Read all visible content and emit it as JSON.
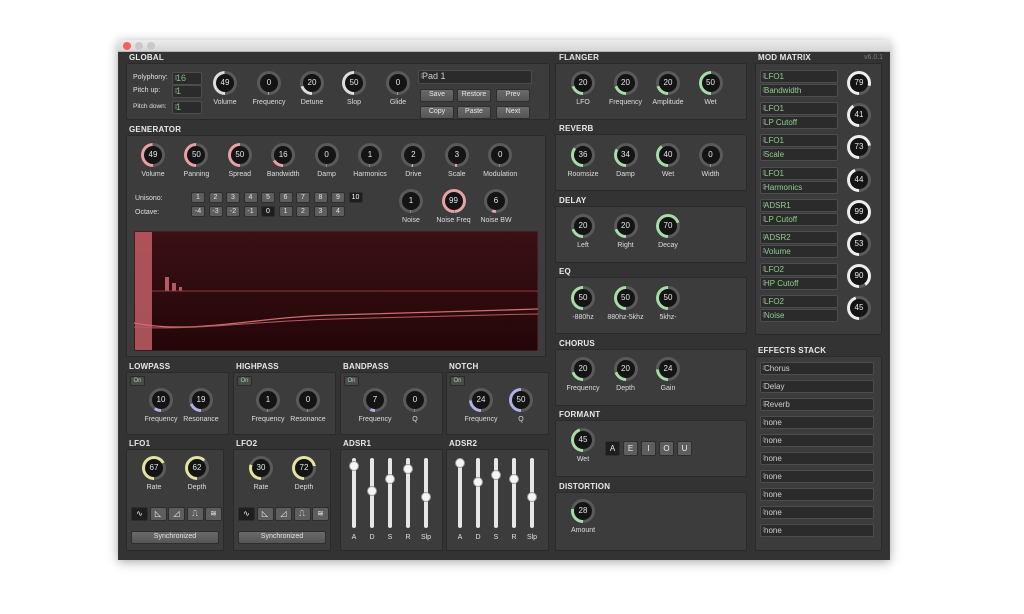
{
  "colors": {
    "accent": "#8fcf8f",
    "panel": "#3c3c3c",
    "window": "#333333"
  },
  "titlebar": {
    "version": "v6.0.1"
  },
  "global": {
    "title": "GLOBAL",
    "polyphony_label": "Polyphony:",
    "polyphony": "16",
    "pitch_up_label": "Pitch up:",
    "pitch_up": "1",
    "pitch_down_label": "Pitch down:",
    "pitch_down": "1",
    "knobs": [
      {
        "label": "Volume",
        "value": "49",
        "color": "#dddddd"
      },
      {
        "label": "Frequency",
        "value": "0",
        "color": "#dddddd"
      },
      {
        "label": "Detune",
        "value": "20",
        "color": "#dddddd"
      },
      {
        "label": "Slop",
        "value": "50",
        "color": "#dddddd"
      },
      {
        "label": "Glide",
        "value": "0",
        "color": "#dddddd"
      }
    ],
    "preset": "Pad 1",
    "buttons": {
      "save": "Save",
      "restore": "Restore",
      "prev": "Prev",
      "copy": "Copy",
      "paste": "Paste",
      "next": "Next"
    }
  },
  "generator": {
    "title": "GENERATOR",
    "knobs": [
      {
        "label": "Volume",
        "value": "49",
        "color": "#e8a0a6"
      },
      {
        "label": "Panning",
        "value": "50",
        "color": "#e8a0a6"
      },
      {
        "label": "Spread",
        "value": "50",
        "color": "#e8a0a6"
      },
      {
        "label": "Bandwidth",
        "value": "16",
        "color": "#e8a0a6"
      },
      {
        "label": "Damp",
        "value": "0",
        "color": "#e8a0a6"
      },
      {
        "label": "Harmonics",
        "value": "1",
        "color": "#e8a0a6"
      },
      {
        "label": "Drive",
        "value": "2",
        "color": "#e8a0a6"
      },
      {
        "label": "Scale",
        "value": "3",
        "color": "#e8a0a6"
      },
      {
        "label": "Modulation",
        "value": "0",
        "color": "#e8a0a6"
      }
    ],
    "unisono_label": "Unisono:",
    "unisono": [
      "1",
      "2",
      "3",
      "4",
      "5",
      "6",
      "7",
      "8",
      "9",
      "10"
    ],
    "octave_label": "Octave:",
    "octave": [
      "-4",
      "-3",
      "-2",
      "-1",
      "0",
      "1",
      "2",
      "3",
      "4"
    ],
    "noise_knobs": [
      {
        "label": "Noise",
        "value": "1",
        "color": "#e8a0a6"
      },
      {
        "label": "Noise Freq",
        "value": "99",
        "color": "#e8a0a6"
      },
      {
        "label": "Noise BW",
        "value": "6",
        "color": "#e8a0a6"
      }
    ]
  },
  "filters": [
    {
      "title": "LOWPASS",
      "on": "On",
      "knobs": [
        {
          "label": "Frequency",
          "value": "10",
          "color": "#b0b0e8"
        },
        {
          "label": "Resonance",
          "value": "19",
          "color": "#b0b0e8"
        }
      ]
    },
    {
      "title": "HIGHPASS",
      "on": "On",
      "knobs": [
        {
          "label": "Frequency",
          "value": "1",
          "color": "#b0b0e8"
        },
        {
          "label": "Resonance",
          "value": "0",
          "color": "#b0b0e8"
        }
      ]
    },
    {
      "title": "BANDPASS",
      "on": "On",
      "knobs": [
        {
          "label": "Frequency",
          "value": "7",
          "color": "#b0b0e8"
        },
        {
          "label": "Q",
          "value": "0",
          "color": "#b0b0e8"
        }
      ]
    },
    {
      "title": "NOTCH",
      "on": "On",
      "knobs": [
        {
          "label": "Frequency",
          "value": "24",
          "color": "#b0b0e8"
        },
        {
          "label": "Q",
          "value": "50",
          "color": "#b0b0e8"
        }
      ]
    }
  ],
  "lfos": [
    {
      "title": "LFO1",
      "knobs": [
        {
          "label": "Rate",
          "value": "67",
          "color": "#e6e2a0"
        },
        {
          "label": "Depth",
          "value": "62",
          "color": "#e6e2a0"
        }
      ],
      "sync": "Synchronized"
    },
    {
      "title": "LFO2",
      "knobs": [
        {
          "label": "Rate",
          "value": "30",
          "color": "#e6e2a0"
        },
        {
          "label": "Depth",
          "value": "72",
          "color": "#e6e2a0"
        }
      ],
      "sync": "Synchronized"
    }
  ],
  "adsr": [
    {
      "title": "ADSR1",
      "labels": [
        "A",
        "D",
        "S",
        "R",
        "Slp"
      ],
      "levels": [
        0.95,
        0.55,
        0.75,
        0.9,
        0.45
      ]
    },
    {
      "title": "ADSR2",
      "labels": [
        "A",
        "D",
        "S",
        "R",
        "Slp"
      ],
      "levels": [
        1.0,
        0.7,
        0.8,
        0.75,
        0.45
      ]
    }
  ],
  "fx": [
    {
      "title": "FLANGER",
      "knobs": [
        {
          "label": "LFO",
          "value": "20",
          "color": "#a6dca6"
        },
        {
          "label": "Frequency",
          "value": "20",
          "color": "#a6dca6"
        },
        {
          "label": "Amplitude",
          "value": "20",
          "color": "#a6dca6"
        },
        {
          "label": "Wet",
          "value": "50",
          "color": "#a6dca6"
        }
      ]
    },
    {
      "title": "REVERB",
      "knobs": [
        {
          "label": "Roomsize",
          "value": "36",
          "color": "#a6dca6"
        },
        {
          "label": "Damp",
          "value": "34",
          "color": "#a6dca6"
        },
        {
          "label": "Wet",
          "value": "40",
          "color": "#a6dca6"
        },
        {
          "label": "Width",
          "value": "0",
          "color": "#a6dca6"
        }
      ]
    },
    {
      "title": "DELAY",
      "knobs": [
        {
          "label": "Left",
          "value": "20",
          "color": "#a6dca6"
        },
        {
          "label": "Right",
          "value": "20",
          "color": "#a6dca6"
        },
        {
          "label": "Decay",
          "value": "70",
          "color": "#a6dca6"
        }
      ]
    },
    {
      "title": "EQ",
      "knobs": [
        {
          "label": "-880hz",
          "value": "50",
          "color": "#a6dca6"
        },
        {
          "label": "880hz-5khz",
          "value": "50",
          "color": "#a6dca6"
        },
        {
          "label": "5khz-",
          "value": "50",
          "color": "#a6dca6"
        }
      ]
    },
    {
      "title": "CHORUS",
      "knobs": [
        {
          "label": "Frequency",
          "value": "20",
          "color": "#a6dca6"
        },
        {
          "label": "Depth",
          "value": "20",
          "color": "#a6dca6"
        },
        {
          "label": "Gain",
          "value": "24",
          "color": "#a6dca6"
        }
      ]
    },
    {
      "title": "FORMANT",
      "knobs": [
        {
          "label": "Wet",
          "value": "45",
          "color": "#a6dca6"
        }
      ],
      "vowels": [
        "A",
        "E",
        "I",
        "O",
        "U"
      ]
    },
    {
      "title": "DISTORTION",
      "knobs": [
        {
          "label": "Amount",
          "value": "28",
          "color": "#a6dca6"
        }
      ]
    }
  ],
  "mod_matrix": {
    "title": "MOD MATRIX",
    "rows": [
      {
        "source": "LFO1",
        "target": "Bandwidth",
        "value": "79"
      },
      {
        "source": "LFO1",
        "target": "LP Cutoff",
        "value": "41"
      },
      {
        "source": "LFO1",
        "target": "Scale",
        "value": "73"
      },
      {
        "source": "LFO1",
        "target": "Harmonics",
        "value": "44"
      },
      {
        "source": "ADSR1",
        "target": "LP Cutoff",
        "value": "99"
      },
      {
        "source": "ADSR2",
        "target": "Volume",
        "value": "53"
      },
      {
        "source": "LFO2",
        "target": "HP Cutoff",
        "value": "90"
      },
      {
        "source": "LFO2",
        "target": "Noise",
        "value": "45"
      }
    ]
  },
  "effects_stack": {
    "title": "EFFECTS STACK",
    "items": [
      "Chorus",
      "Delay",
      "Reverb",
      "none",
      "none",
      "none",
      "none",
      "none",
      "none",
      "none"
    ]
  }
}
